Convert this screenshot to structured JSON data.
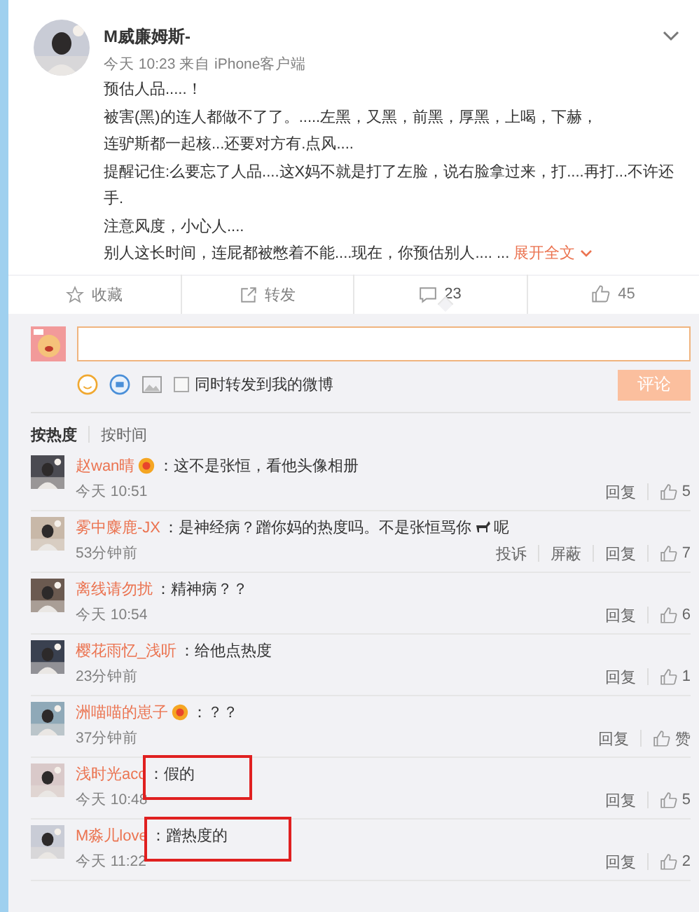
{
  "post": {
    "author": "M威廉姆斯-",
    "meta": "今天 10:23 来自 iPhone客户端",
    "lines": [
      "预估人品.....！",
      "被害(黑)的连人都做不了了。.....左黑，又黑，前黑，厚黑，上喝，下赫，",
      "连驴斯都一起核...还要对方有.点风....",
      "提醒记住:么要忘了人品....这X妈不就是打了左脸，说右脸拿过来，打....再打...不许还手.",
      "注意风度，小心人...."
    ],
    "last_line": "别人这长时间，连屁都被憋着不能....现在，你预估别人.... ... ",
    "expand": "展开全文"
  },
  "actions": [
    {
      "kind": "star",
      "label": "收藏",
      "selected": false
    },
    {
      "kind": "share",
      "label": "转发",
      "selected": false
    },
    {
      "kind": "comment",
      "label": "23",
      "selected": true
    },
    {
      "kind": "like",
      "label": "45",
      "selected": false
    }
  ],
  "composer": {
    "repost_label": "同时转发到我的微博",
    "repost_checked": false,
    "submit": "评论"
  },
  "sort_tabs": [
    {
      "label": "按热度",
      "selected": true
    },
    {
      "label": "按时间",
      "selected": false
    }
  ],
  "comments": [
    {
      "name": "赵wan晴",
      "badge": true,
      "text": "：这不是张恒，看他头像相册",
      "time": "今天 10:51",
      "reply": "回复",
      "likes": "5",
      "highlighted": false
    },
    {
      "name": "雾中麋鹿-JX",
      "badge": false,
      "text": "：是神经病？蹭你妈的热度吗。不是张恒骂你",
      "emoji_after": "呢",
      "time": "53分钟前",
      "extra_actions": [
        "投诉",
        "屏蔽"
      ],
      "reply": "回复",
      "likes": "7",
      "highlighted": false
    },
    {
      "name": "离线请勿扰",
      "badge": false,
      "text": "：精神病？？",
      "time": "今天 10:54",
      "reply": "回复",
      "likes": "6",
      "highlighted": false
    },
    {
      "name": "樱花雨忆_浅听",
      "badge": false,
      "text": "：给他点热度",
      "time": "23分钟前",
      "reply": "回复",
      "likes": "1",
      "highlighted": false
    },
    {
      "name": "洲喵喵的崽子",
      "badge": true,
      "text": "：？？",
      "time": "37分钟前",
      "reply": "回复",
      "likes": "赞",
      "highlighted": false
    },
    {
      "name": "浅时光acc",
      "badge": false,
      "text": "：假的",
      "time": "今天 10:48",
      "reply": "回复",
      "likes": "5",
      "highlighted": true
    },
    {
      "name": "M淼儿love",
      "badge": false,
      "text": "：蹭热度的",
      "time": "今天 11:22",
      "reply": "回复",
      "likes": "2",
      "highlighted": true
    }
  ]
}
